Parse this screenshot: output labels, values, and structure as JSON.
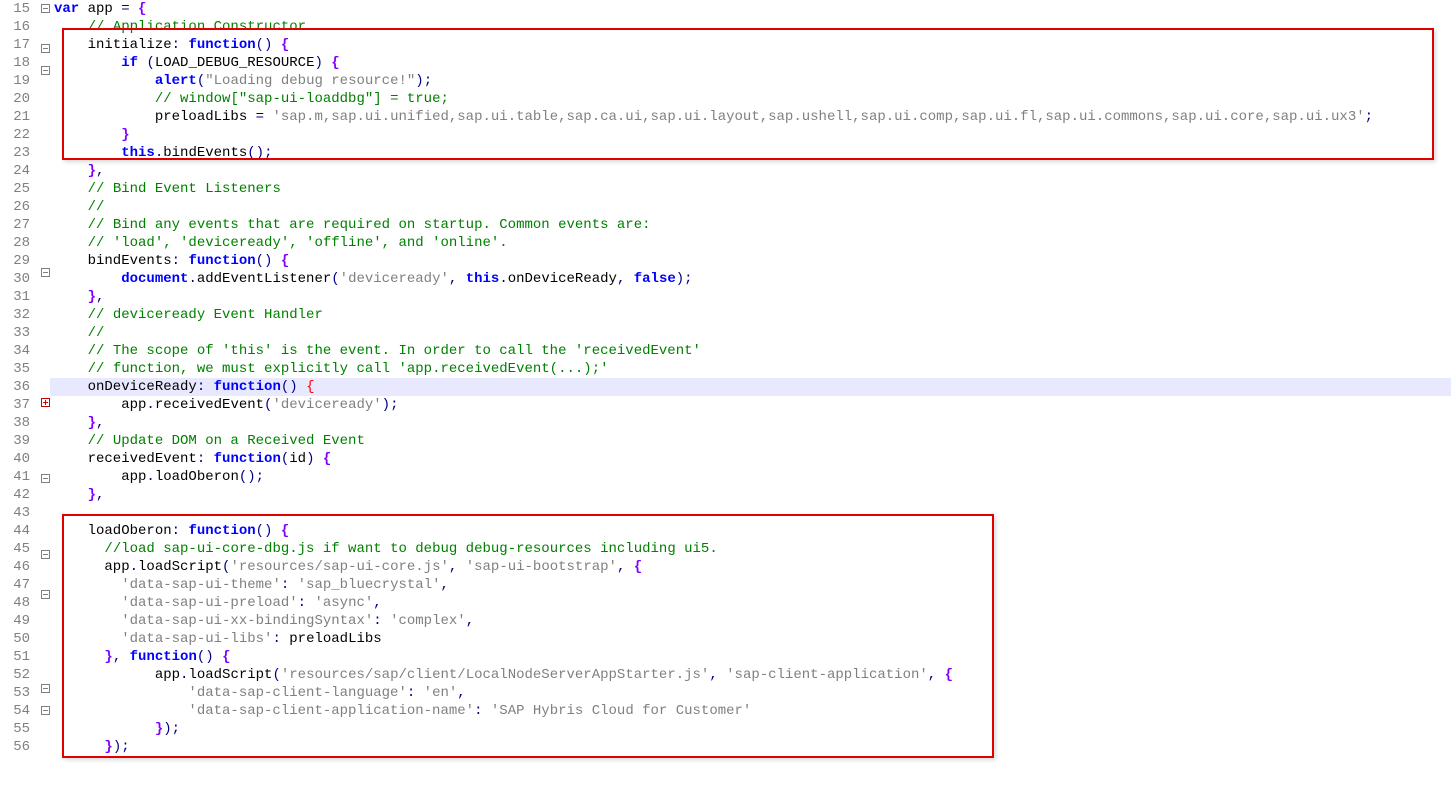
{
  "firstLine": 15,
  "highlightLine": 36,
  "folds": {
    "15": "open",
    "17": "open",
    "18": "open",
    "29": "open",
    "36": "closed",
    "40": "open",
    "44": "open",
    "46": "open",
    "51": "open",
    "52": "open"
  },
  "boxes": [
    {
      "startLine": 17,
      "endLine": 23
    },
    {
      "startLine": 44,
      "endLine": 56
    }
  ],
  "lines": [
    {
      "n": 15,
      "tokens": [
        [
          "kw",
          "var"
        ],
        [
          "",
          " app "
        ],
        [
          "punct",
          "="
        ],
        [
          "",
          " "
        ],
        [
          "pbrace",
          "{"
        ]
      ]
    },
    {
      "n": 16,
      "tokens": [
        [
          "",
          "    "
        ],
        [
          "com",
          "// Application Constructor"
        ]
      ]
    },
    {
      "n": 17,
      "tokens": [
        [
          "",
          "    initialize"
        ],
        [
          "punct",
          ":"
        ],
        [
          "",
          " "
        ],
        [
          "kw",
          "function"
        ],
        [
          "punct",
          "()"
        ],
        [
          "",
          " "
        ],
        [
          "pbrace",
          "{"
        ]
      ]
    },
    {
      "n": 18,
      "tokens": [
        [
          "",
          "        "
        ],
        [
          "kw",
          "if"
        ],
        [
          "",
          " "
        ],
        [
          "punct",
          "("
        ],
        [
          "",
          "LOAD_DEBUG_RESOURCE"
        ],
        [
          "punct",
          ")"
        ],
        [
          "",
          " "
        ],
        [
          "pbrace",
          "{"
        ]
      ]
    },
    {
      "n": 19,
      "tokens": [
        [
          "",
          "            "
        ],
        [
          "kw",
          "alert"
        ],
        [
          "punct",
          "("
        ],
        [
          "str",
          "\"Loading debug resource!\""
        ],
        [
          "punct",
          ")"
        ],
        [
          "punct",
          ";"
        ]
      ]
    },
    {
      "n": 20,
      "tokens": [
        [
          "",
          "            "
        ],
        [
          "com",
          "// window[\"sap-ui-loaddbg\"] = true;"
        ]
      ]
    },
    {
      "n": 21,
      "tokens": [
        [
          "",
          "            preloadLibs "
        ],
        [
          "punct",
          "="
        ],
        [
          "",
          " "
        ],
        [
          "str",
          "'sap.m,sap.ui.unified,sap.ui.table,sap.ca.ui,sap.ui.layout,sap.ushell,sap.ui.comp,sap.ui.fl,sap.ui.commons,sap.ui.core,sap.ui.ux3'"
        ],
        [
          "punct",
          ";"
        ]
      ]
    },
    {
      "n": 22,
      "tokens": [
        [
          "",
          "        "
        ],
        [
          "pbrace",
          "}"
        ]
      ]
    },
    {
      "n": 23,
      "tokens": [
        [
          "",
          "        "
        ],
        [
          "kw",
          "this"
        ],
        [
          "punct",
          "."
        ],
        [
          "",
          "bindEvents"
        ],
        [
          "punct",
          "()"
        ],
        [
          "punct",
          ";"
        ]
      ]
    },
    {
      "n": 24,
      "tokens": [
        [
          "",
          "    "
        ],
        [
          "pbrace",
          "}"
        ],
        [
          "punct",
          ","
        ]
      ]
    },
    {
      "n": 25,
      "tokens": [
        [
          "",
          "    "
        ],
        [
          "com",
          "// Bind Event Listeners"
        ]
      ]
    },
    {
      "n": 26,
      "tokens": [
        [
          "",
          "    "
        ],
        [
          "com",
          "//"
        ]
      ]
    },
    {
      "n": 27,
      "tokens": [
        [
          "",
          "    "
        ],
        [
          "com",
          "// Bind any events that are required on startup. Common events are:"
        ]
      ]
    },
    {
      "n": 28,
      "tokens": [
        [
          "",
          "    "
        ],
        [
          "com",
          "// 'load', 'deviceready', 'offline', and 'online'."
        ]
      ]
    },
    {
      "n": 29,
      "tokens": [
        [
          "",
          "    bindEvents"
        ],
        [
          "punct",
          ":"
        ],
        [
          "",
          " "
        ],
        [
          "kw",
          "function"
        ],
        [
          "punct",
          "()"
        ],
        [
          "",
          " "
        ],
        [
          "pbrace",
          "{"
        ]
      ]
    },
    {
      "n": 30,
      "tokens": [
        [
          "",
          "        "
        ],
        [
          "kw",
          "document"
        ],
        [
          "punct",
          "."
        ],
        [
          "",
          "addEventListener"
        ],
        [
          "punct",
          "("
        ],
        [
          "str",
          "'deviceready'"
        ],
        [
          "punct",
          ","
        ],
        [
          "",
          " "
        ],
        [
          "kw",
          "this"
        ],
        [
          "punct",
          "."
        ],
        [
          "",
          "onDeviceReady"
        ],
        [
          "punct",
          ","
        ],
        [
          "",
          " "
        ],
        [
          "kw",
          "false"
        ],
        [
          "punct",
          ")"
        ],
        [
          "punct",
          ";"
        ]
      ]
    },
    {
      "n": 31,
      "tokens": [
        [
          "",
          "    "
        ],
        [
          "pbrace",
          "}"
        ],
        [
          "punct",
          ","
        ]
      ]
    },
    {
      "n": 32,
      "tokens": [
        [
          "",
          "    "
        ],
        [
          "com",
          "// deviceready Event Handler"
        ]
      ]
    },
    {
      "n": 33,
      "tokens": [
        [
          "",
          "    "
        ],
        [
          "com",
          "//"
        ]
      ]
    },
    {
      "n": 34,
      "tokens": [
        [
          "",
          "    "
        ],
        [
          "com",
          "// The scope of 'this' is the event. In order to call the 'receivedEvent'"
        ]
      ]
    },
    {
      "n": 35,
      "tokens": [
        [
          "",
          "    "
        ],
        [
          "com",
          "// function, we must explicitly call 'app.receivedEvent(...);'"
        ]
      ]
    },
    {
      "n": 36,
      "tokens": [
        [
          "",
          "    onDeviceReady"
        ],
        [
          "punct",
          ":"
        ],
        [
          "",
          " "
        ],
        [
          "kw",
          "function"
        ],
        [
          "punct",
          "()"
        ],
        [
          "",
          " "
        ],
        [
          "redbr",
          "{"
        ]
      ]
    },
    {
      "n": 37,
      "tokens": [
        [
          "",
          "        app"
        ],
        [
          "punct",
          "."
        ],
        [
          "",
          "receivedEvent"
        ],
        [
          "punct",
          "("
        ],
        [
          "str",
          "'deviceready'"
        ],
        [
          "punct",
          ")"
        ],
        [
          "punct",
          ";"
        ]
      ]
    },
    {
      "n": 38,
      "tokens": [
        [
          "",
          "    "
        ],
        [
          "pbrace",
          "}"
        ],
        [
          "punct",
          ","
        ]
      ]
    },
    {
      "n": 39,
      "tokens": [
        [
          "",
          "    "
        ],
        [
          "com",
          "// Update DOM on a Received Event"
        ]
      ]
    },
    {
      "n": 40,
      "tokens": [
        [
          "",
          "    receivedEvent"
        ],
        [
          "punct",
          ":"
        ],
        [
          "",
          " "
        ],
        [
          "kw",
          "function"
        ],
        [
          "punct",
          "("
        ],
        [
          "",
          "id"
        ],
        [
          "punct",
          ")"
        ],
        [
          "",
          " "
        ],
        [
          "pbrace",
          "{"
        ]
      ]
    },
    {
      "n": 41,
      "tokens": [
        [
          "",
          "        app"
        ],
        [
          "punct",
          "."
        ],
        [
          "",
          "loadOberon"
        ],
        [
          "punct",
          "()"
        ],
        [
          "punct",
          ";"
        ]
      ]
    },
    {
      "n": 42,
      "tokens": [
        [
          "",
          "    "
        ],
        [
          "pbrace",
          "}"
        ],
        [
          "punct",
          ","
        ]
      ]
    },
    {
      "n": 43,
      "tokens": []
    },
    {
      "n": 44,
      "tokens": [
        [
          "",
          "    loadOberon"
        ],
        [
          "punct",
          ":"
        ],
        [
          "",
          " "
        ],
        [
          "kw",
          "function"
        ],
        [
          "punct",
          "()"
        ],
        [
          "",
          " "
        ],
        [
          "pbrace",
          "{"
        ]
      ]
    },
    {
      "n": 45,
      "tokens": [
        [
          "",
          "      "
        ],
        [
          "com",
          "//load sap-ui-core-dbg.js if want to debug debug-resources including ui5."
        ]
      ]
    },
    {
      "n": 46,
      "tokens": [
        [
          "",
          "      app"
        ],
        [
          "punct",
          "."
        ],
        [
          "",
          "loadScript"
        ],
        [
          "punct",
          "("
        ],
        [
          "str",
          "'resources/sap-ui-core.js'"
        ],
        [
          "punct",
          ","
        ],
        [
          "",
          " "
        ],
        [
          "str",
          "'sap-ui-bootstrap'"
        ],
        [
          "punct",
          ","
        ],
        [
          "",
          " "
        ],
        [
          "pbrace",
          "{"
        ]
      ]
    },
    {
      "n": 47,
      "tokens": [
        [
          "",
          "        "
        ],
        [
          "str",
          "'data-sap-ui-theme'"
        ],
        [
          "punct",
          ":"
        ],
        [
          "",
          " "
        ],
        [
          "str",
          "'sap_bluecrystal'"
        ],
        [
          "punct",
          ","
        ]
      ]
    },
    {
      "n": 48,
      "tokens": [
        [
          "",
          "        "
        ],
        [
          "str",
          "'data-sap-ui-preload'"
        ],
        [
          "punct",
          ":"
        ],
        [
          "",
          " "
        ],
        [
          "str",
          "'async'"
        ],
        [
          "punct",
          ","
        ]
      ]
    },
    {
      "n": 49,
      "tokens": [
        [
          "",
          "        "
        ],
        [
          "str",
          "'data-sap-ui-xx-bindingSyntax'"
        ],
        [
          "punct",
          ":"
        ],
        [
          "",
          " "
        ],
        [
          "str",
          "'complex'"
        ],
        [
          "punct",
          ","
        ]
      ]
    },
    {
      "n": 50,
      "tokens": [
        [
          "",
          "        "
        ],
        [
          "str",
          "'data-sap-ui-libs'"
        ],
        [
          "punct",
          ":"
        ],
        [
          "",
          " preloadLibs"
        ]
      ]
    },
    {
      "n": 51,
      "tokens": [
        [
          "",
          "      "
        ],
        [
          "pbrace",
          "}"
        ],
        [
          "punct",
          ","
        ],
        [
          "",
          " "
        ],
        [
          "kw",
          "function"
        ],
        [
          "punct",
          "()"
        ],
        [
          "",
          " "
        ],
        [
          "pbrace",
          "{"
        ]
      ]
    },
    {
      "n": 52,
      "tokens": [
        [
          "",
          "            app"
        ],
        [
          "punct",
          "."
        ],
        [
          "",
          "loadScript"
        ],
        [
          "punct",
          "("
        ],
        [
          "str",
          "'resources/sap/client/LocalNodeServerAppStarter.js'"
        ],
        [
          "punct",
          ","
        ],
        [
          "",
          " "
        ],
        [
          "str",
          "'sap-client-application'"
        ],
        [
          "punct",
          ","
        ],
        [
          "",
          " "
        ],
        [
          "pbrace",
          "{"
        ]
      ]
    },
    {
      "n": 53,
      "tokens": [
        [
          "",
          "                "
        ],
        [
          "str",
          "'data-sap-client-language'"
        ],
        [
          "punct",
          ":"
        ],
        [
          "",
          " "
        ],
        [
          "str",
          "'en'"
        ],
        [
          "punct",
          ","
        ]
      ]
    },
    {
      "n": 54,
      "tokens": [
        [
          "",
          "                "
        ],
        [
          "str",
          "'data-sap-client-application-name'"
        ],
        [
          "punct",
          ":"
        ],
        [
          "",
          " "
        ],
        [
          "str",
          "'SAP Hybris Cloud for Customer'"
        ]
      ]
    },
    {
      "n": 55,
      "tokens": [
        [
          "",
          "            "
        ],
        [
          "pbrace",
          "}"
        ],
        [
          "punct",
          ")"
        ],
        [
          "punct",
          ";"
        ]
      ]
    },
    {
      "n": 56,
      "tokens": [
        [
          "",
          "      "
        ],
        [
          "pbrace",
          "}"
        ],
        [
          "punct",
          ")"
        ],
        [
          "punct",
          ";"
        ]
      ]
    }
  ]
}
